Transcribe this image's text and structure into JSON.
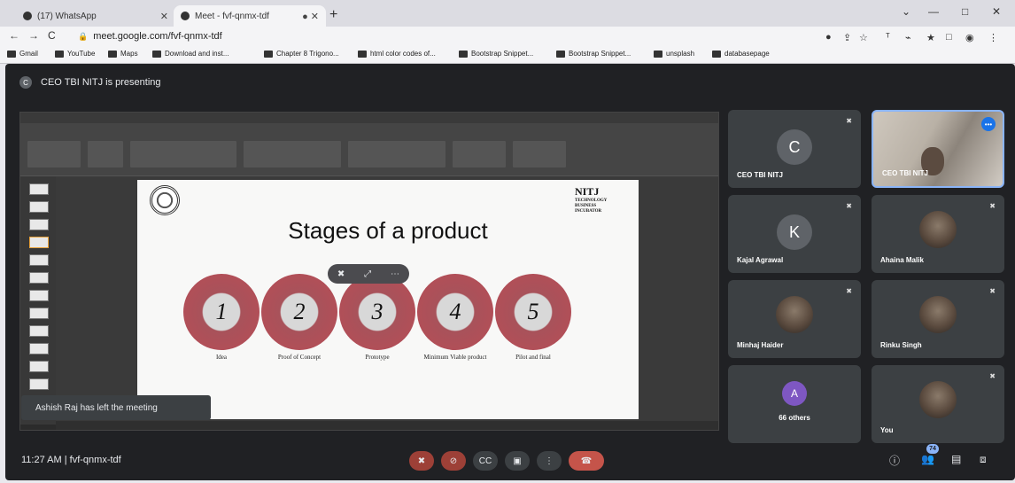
{
  "browser": {
    "tabs": [
      {
        "label": "(17) WhatsApp"
      },
      {
        "label": "Meet - fvf-qnmx-tdf"
      }
    ],
    "url": "meet.google.com/fvf-qnmx-tdf",
    "bookmarks": [
      "Gmail",
      "YouTube",
      "Maps",
      "Download and inst...",
      "Chapter 8 Trigono...",
      "html color codes of...",
      "Bootstrap Snippet...",
      "Bootstrap Snippet...",
      "unsplash",
      "databasepage"
    ]
  },
  "meet": {
    "presenting_text": "CEO TBI NITJ is presenting",
    "presenter_initial": "C",
    "slide": {
      "title": "Stages of a product",
      "logo_name": "NITJ",
      "logo_lines": [
        "TECHNOLOGY",
        "BUSINESS",
        "INCUBATOR"
      ],
      "stages": [
        {
          "num": "1",
          "label": "Idea"
        },
        {
          "num": "2",
          "label": "Proof of Concept"
        },
        {
          "num": "3",
          "label": "Prototype"
        },
        {
          "num": "4",
          "label": "Minimum Viable product"
        },
        {
          "num": "5",
          "label": "Pilot and final"
        }
      ]
    },
    "toast": "Ashish Raj has left the meeting",
    "participants": [
      {
        "name": "CEO TBI NITJ",
        "initial": "C",
        "color": "#5f6368"
      },
      {
        "name": "CEO TBI NITJ"
      },
      {
        "name": "Kajal Agrawal",
        "initial": "K",
        "color": "#5f6368"
      },
      {
        "name": "Ahaina Malik"
      },
      {
        "name": "Minhaj Haider"
      },
      {
        "name": "Rinku Singh"
      },
      {
        "name": "66 others",
        "initial": "A"
      },
      {
        "name": "You"
      }
    ],
    "time": "11:27 AM",
    "meeting_code": "fvf-qnmx-tdf",
    "participant_count": "74",
    "controls": [
      "mic-off",
      "camera-off",
      "captions",
      "present",
      "more",
      "end-call"
    ]
  }
}
